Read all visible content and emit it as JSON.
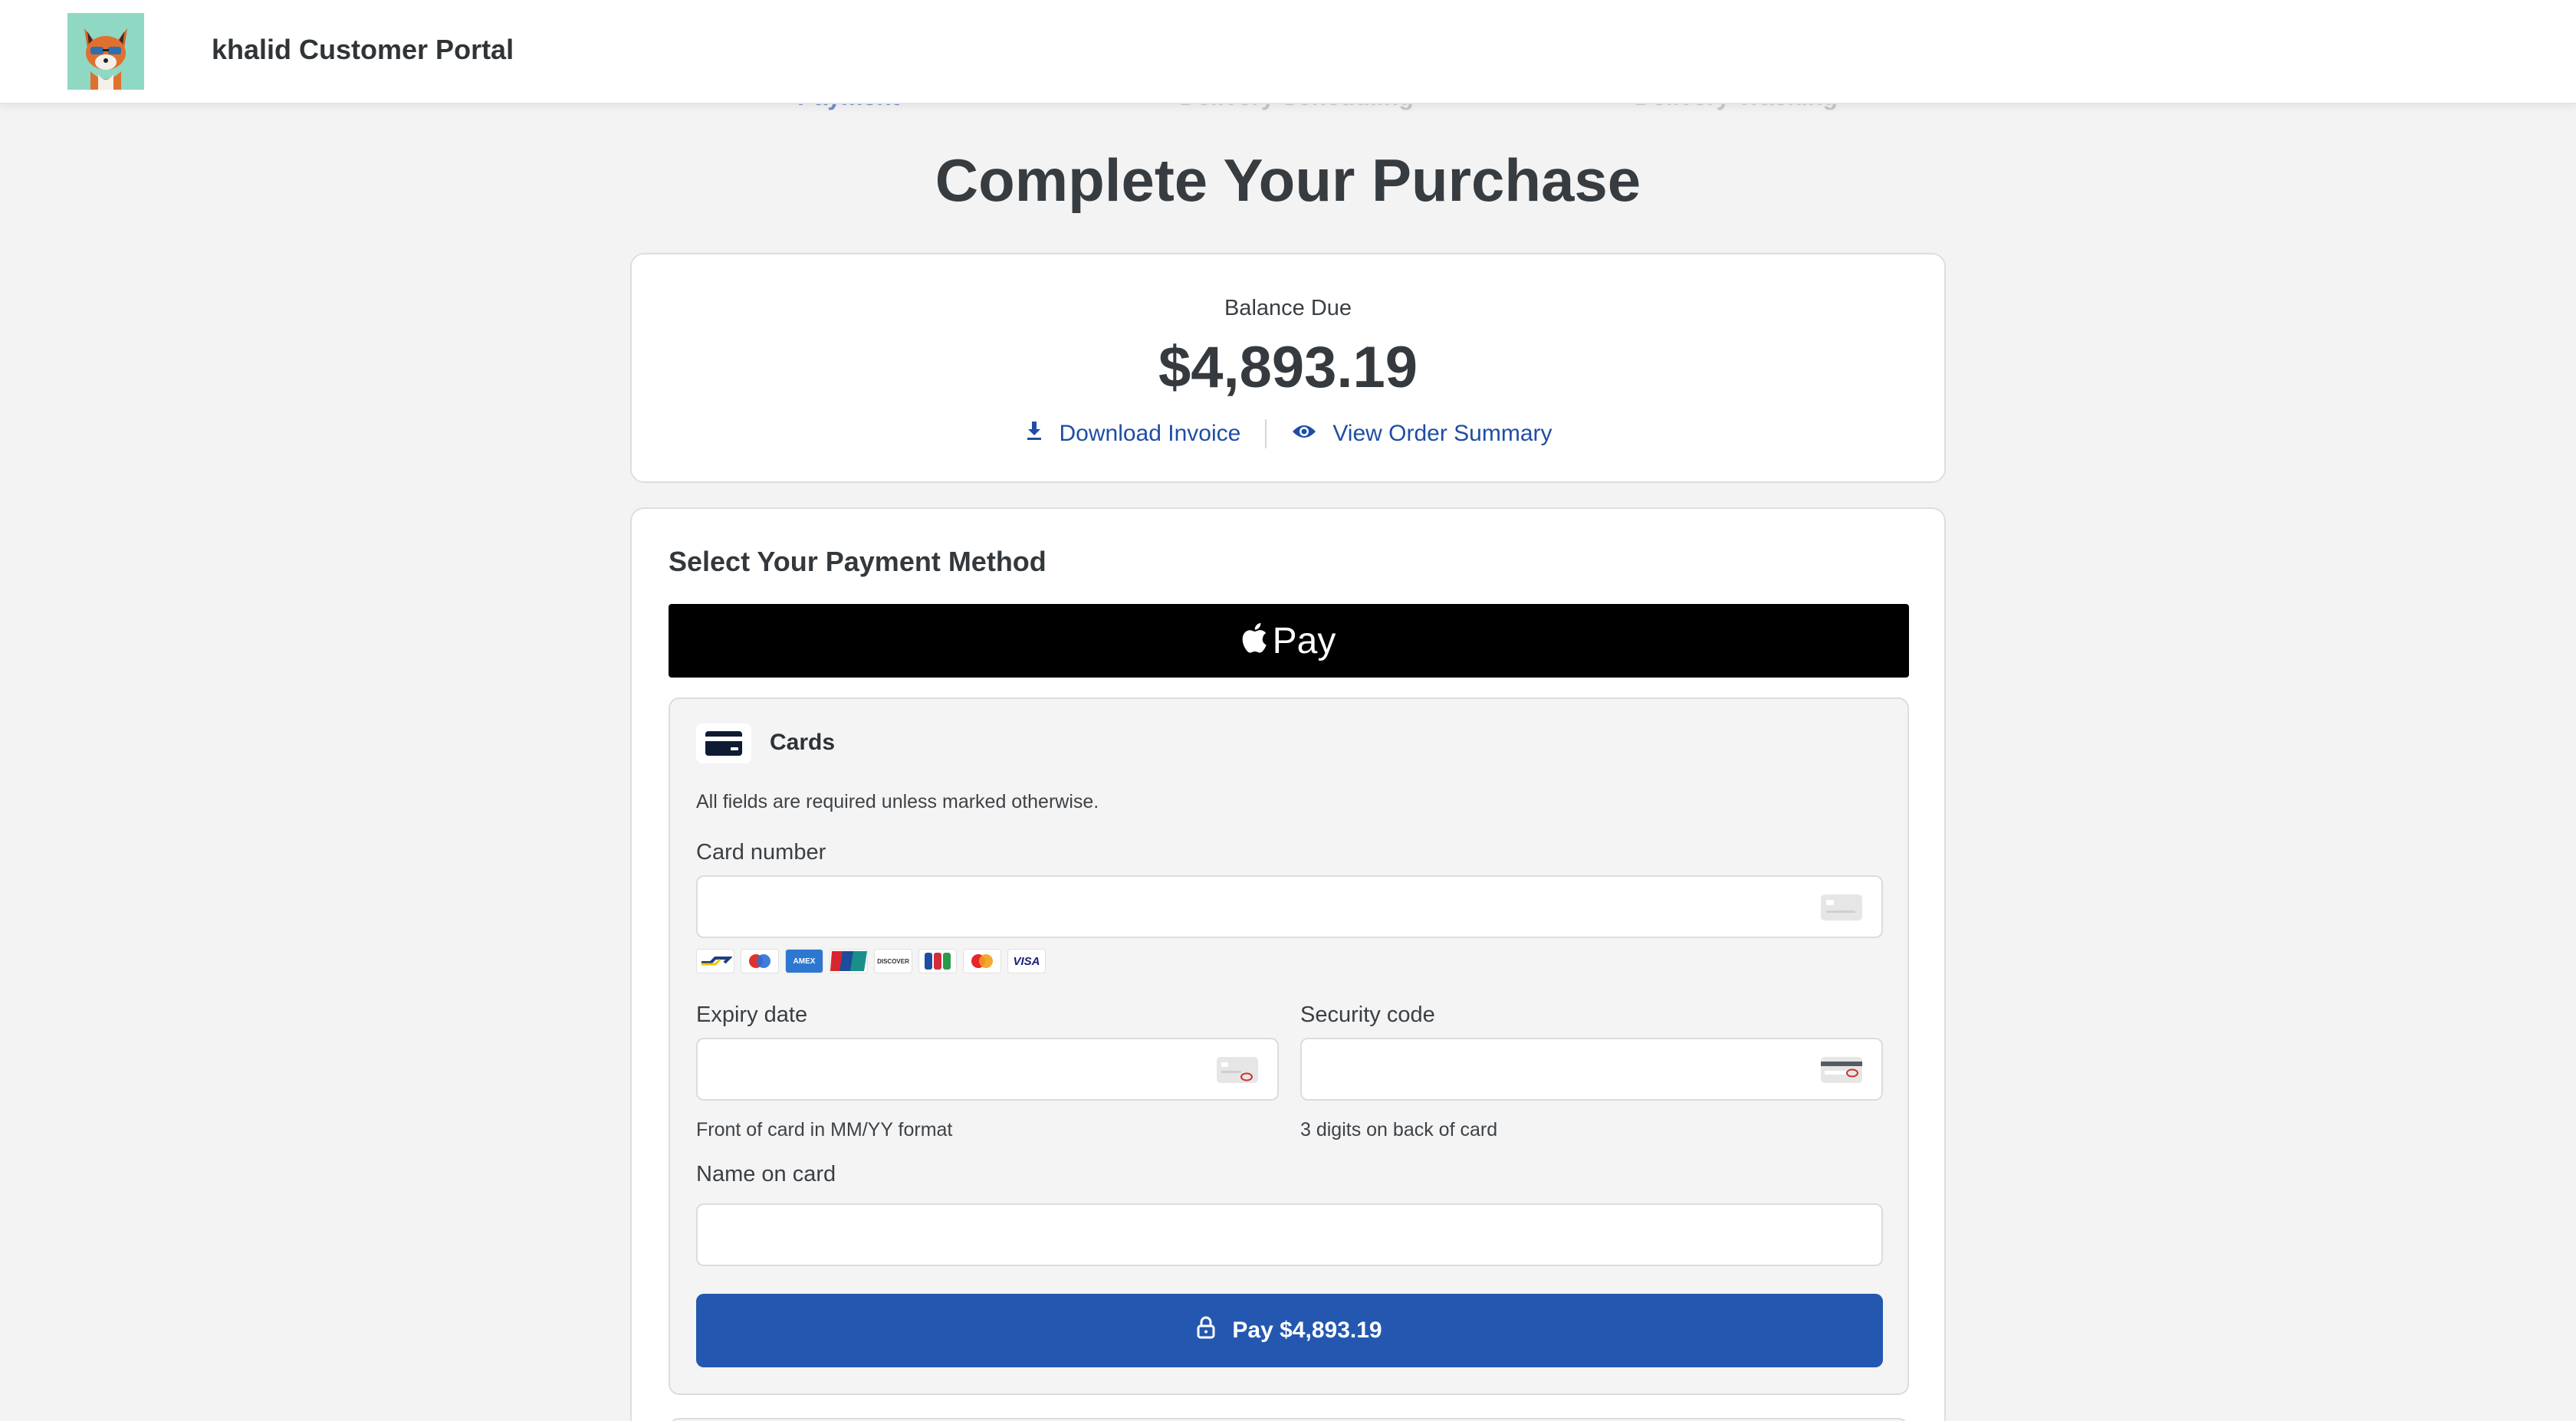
{
  "header": {
    "portal_title": "khalid Customer Portal",
    "logo_icon": "fox-avatar"
  },
  "stepper": {
    "steps": [
      {
        "label": "Payment",
        "state": "active"
      },
      {
        "label": "Delivery Scheduling",
        "state": "upcoming"
      },
      {
        "label": "Delivery Tracking",
        "state": "upcoming"
      }
    ]
  },
  "page": {
    "heading": "Complete Your Purchase"
  },
  "balance": {
    "label": "Balance Due",
    "amount": "$4,893.19",
    "download_invoice": "Download Invoice",
    "view_order_summary": "View Order Summary"
  },
  "payment": {
    "section_title": "Select Your Payment Method",
    "apple_pay_label": "Pay",
    "cards": {
      "title": "Cards",
      "required_note": "All fields are required unless marked otherwise.",
      "card_number_label": "Card number",
      "card_number_value": "",
      "brands": [
        "Bancontact",
        "Maestro",
        "American Express",
        "UnionPay",
        "Discover",
        "JCB",
        "Mastercard",
        "VISA"
      ],
      "expiry_label": "Expiry date",
      "expiry_value": "",
      "expiry_hint": "Front of card in MM/YY format",
      "security_label": "Security code",
      "security_value": "",
      "security_hint": "3 digits on back of card",
      "name_label": "Name on card",
      "name_value": "",
      "pay_button": "Pay $4,893.19"
    }
  },
  "colors": {
    "accent": "#2457b0",
    "link": "#1f4ea3",
    "apple_pay_bg": "#000000",
    "page_bg": "#f3f3f3"
  }
}
